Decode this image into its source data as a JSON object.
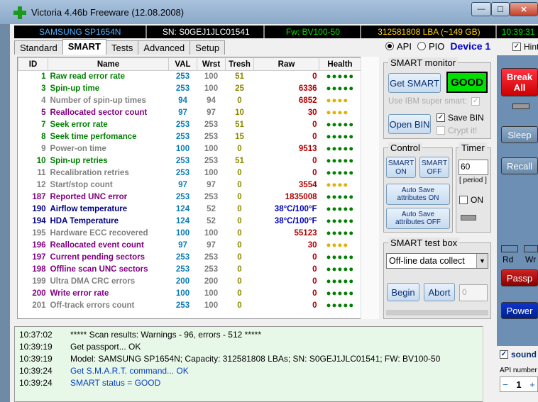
{
  "window": {
    "title": "Victoria 4.46b Freeware (12.08.2008)",
    "min": "—",
    "max": "☐",
    "close": "✕"
  },
  "infobar": {
    "model": "SAMSUNG SP1654N",
    "serial": "SN: S0GEJ1JLC01541",
    "firmware": "Fw: BV100-50",
    "lba": "312581808 LBA (~149 GB)",
    "time": "10:39:31"
  },
  "tabs": [
    "Standard",
    "SMART",
    "Tests",
    "Advanced",
    "Setup"
  ],
  "mode": {
    "api": "API",
    "pio": "PIO",
    "device": "Device 1"
  },
  "hint_label": "Hint",
  "table": {
    "headers": [
      "ID",
      "Name",
      "VAL",
      "Wrst",
      "Tresh",
      "Raw",
      "Health"
    ],
    "rows": [
      {
        "id": "1",
        "name": "Raw read error rate",
        "val": "253",
        "wrst": "100",
        "tresh": "51",
        "raw": "0",
        "health": "●●●●●",
        "color": "green"
      },
      {
        "id": "3",
        "name": "Spin-up time",
        "val": "253",
        "wrst": "100",
        "tresh": "25",
        "raw": "6336",
        "health": "●●●●●",
        "color": "green"
      },
      {
        "id": "4",
        "name": "Number of spin-up times",
        "val": "94",
        "wrst": "94",
        "tresh": "0",
        "raw": "6852",
        "health": "●●●●",
        "color": "gray"
      },
      {
        "id": "5",
        "name": "Reallocated sector count",
        "val": "97",
        "wrst": "97",
        "tresh": "10",
        "raw": "30",
        "health": "●●●●",
        "color": "purple"
      },
      {
        "id": "7",
        "name": "Seek error rate",
        "val": "253",
        "wrst": "253",
        "tresh": "51",
        "raw": "0",
        "health": "●●●●●",
        "color": "green"
      },
      {
        "id": "8",
        "name": "Seek time perfomance",
        "val": "253",
        "wrst": "253",
        "tresh": "15",
        "raw": "0",
        "health": "●●●●●",
        "color": "green"
      },
      {
        "id": "9",
        "name": "Power-on time",
        "val": "100",
        "wrst": "100",
        "tresh": "0",
        "raw": "9513",
        "health": "●●●●●",
        "color": "gray"
      },
      {
        "id": "10",
        "name": "Spin-up retries",
        "val": "253",
        "wrst": "253",
        "tresh": "51",
        "raw": "0",
        "health": "●●●●●",
        "color": "green"
      },
      {
        "id": "11",
        "name": "Recalibration retries",
        "val": "253",
        "wrst": "100",
        "tresh": "0",
        "raw": "0",
        "health": "●●●●●",
        "color": "gray"
      },
      {
        "id": "12",
        "name": "Start/stop count",
        "val": "97",
        "wrst": "97",
        "tresh": "0",
        "raw": "3554",
        "health": "●●●●",
        "color": "gray"
      },
      {
        "id": "187",
        "name": "Reported UNC error",
        "val": "253",
        "wrst": "253",
        "tresh": "0",
        "raw": "1835008",
        "health": "●●●●●",
        "color": "purple"
      },
      {
        "id": "190",
        "name": "Airflow temperature",
        "val": "124",
        "wrst": "52",
        "tresh": "0",
        "raw": "38°C/100°F",
        "health": "●●●●●",
        "color": "blue",
        "rawblue": true
      },
      {
        "id": "194",
        "name": "HDA Temperature",
        "val": "124",
        "wrst": "52",
        "tresh": "0",
        "raw": "38°C/100°F",
        "health": "●●●●●",
        "color": "blue",
        "rawblue": true
      },
      {
        "id": "195",
        "name": "Hardware ECC recovered",
        "val": "100",
        "wrst": "100",
        "tresh": "0",
        "raw": "55123",
        "health": "●●●●●",
        "color": "gray"
      },
      {
        "id": "196",
        "name": "Reallocated event count",
        "val": "97",
        "wrst": "97",
        "tresh": "0",
        "raw": "30",
        "health": "●●●●",
        "color": "purple"
      },
      {
        "id": "197",
        "name": "Current pending sectors",
        "val": "253",
        "wrst": "253",
        "tresh": "0",
        "raw": "0",
        "health": "●●●●●",
        "color": "purple"
      },
      {
        "id": "198",
        "name": "Offline scan UNC sectors",
        "val": "253",
        "wrst": "253",
        "tresh": "0",
        "raw": "0",
        "health": "●●●●●",
        "color": "purple"
      },
      {
        "id": "199",
        "name": "Ultra DMA CRC errors",
        "val": "200",
        "wrst": "200",
        "tresh": "0",
        "raw": "0",
        "health": "●●●●●",
        "color": "gray"
      },
      {
        "id": "200",
        "name": "Write error rate",
        "val": "100",
        "wrst": "100",
        "tresh": "0",
        "raw": "0",
        "health": "●●●●●",
        "color": "purple"
      },
      {
        "id": "201",
        "name": "Off-track errors count",
        "val": "253",
        "wrst": "100",
        "tresh": "0",
        "raw": "0",
        "health": "●●●●●",
        "color": "gray"
      }
    ]
  },
  "smart_monitor": {
    "title": "SMART monitor",
    "get_smart": "Get SMART",
    "status": "GOOD",
    "ibm": "Use IBM super smart:",
    "save_bin": "Save BIN",
    "open_bin": "Open BIN",
    "crypt": "Crypt it!"
  },
  "control": {
    "title": "Control",
    "smart_on": "SMART ON",
    "smart_off": "SMART OFF",
    "autosave_on": "Auto Save attributes ON",
    "autosave_off": "Auto Save attributes OFF"
  },
  "timer": {
    "title": "Timer",
    "value": "60",
    "period": "[ period ]",
    "on": "ON"
  },
  "testbox": {
    "title": "SMART test box",
    "selected": "Off-line data collect",
    "begin": "Begin",
    "abort": "Abort",
    "value": "0"
  },
  "log": [
    {
      "t": "10:37:02",
      "m": "***** Scan results: Warnings - 96, errors - 512 *****",
      "blue": false
    },
    {
      "t": "10:39:19",
      "m": "Get passport... OK",
      "blue": false
    },
    {
      "t": "10:39:19",
      "m": "Model: SAMSUNG SP1654N; Capacity: 312581808 LBAs; SN: S0GEJ1JLC01541; FW: BV100-50",
      "blue": false
    },
    {
      "t": "10:39:24",
      "m": "Get S.M.A.R.T. command... OK",
      "blue": true
    },
    {
      "t": "10:39:24",
      "m": "SMART status = GOOD",
      "blue": true
    }
  ],
  "right": {
    "break": "Break All",
    "sleep": "Sleep",
    "recall": "Recall",
    "rd": "Rd",
    "wr": "Wr",
    "passp": "Passp",
    "power": "Power",
    "sound": "sound",
    "api_number": "API number",
    "api_value": "1",
    "minus": "−",
    "plus": "+"
  }
}
